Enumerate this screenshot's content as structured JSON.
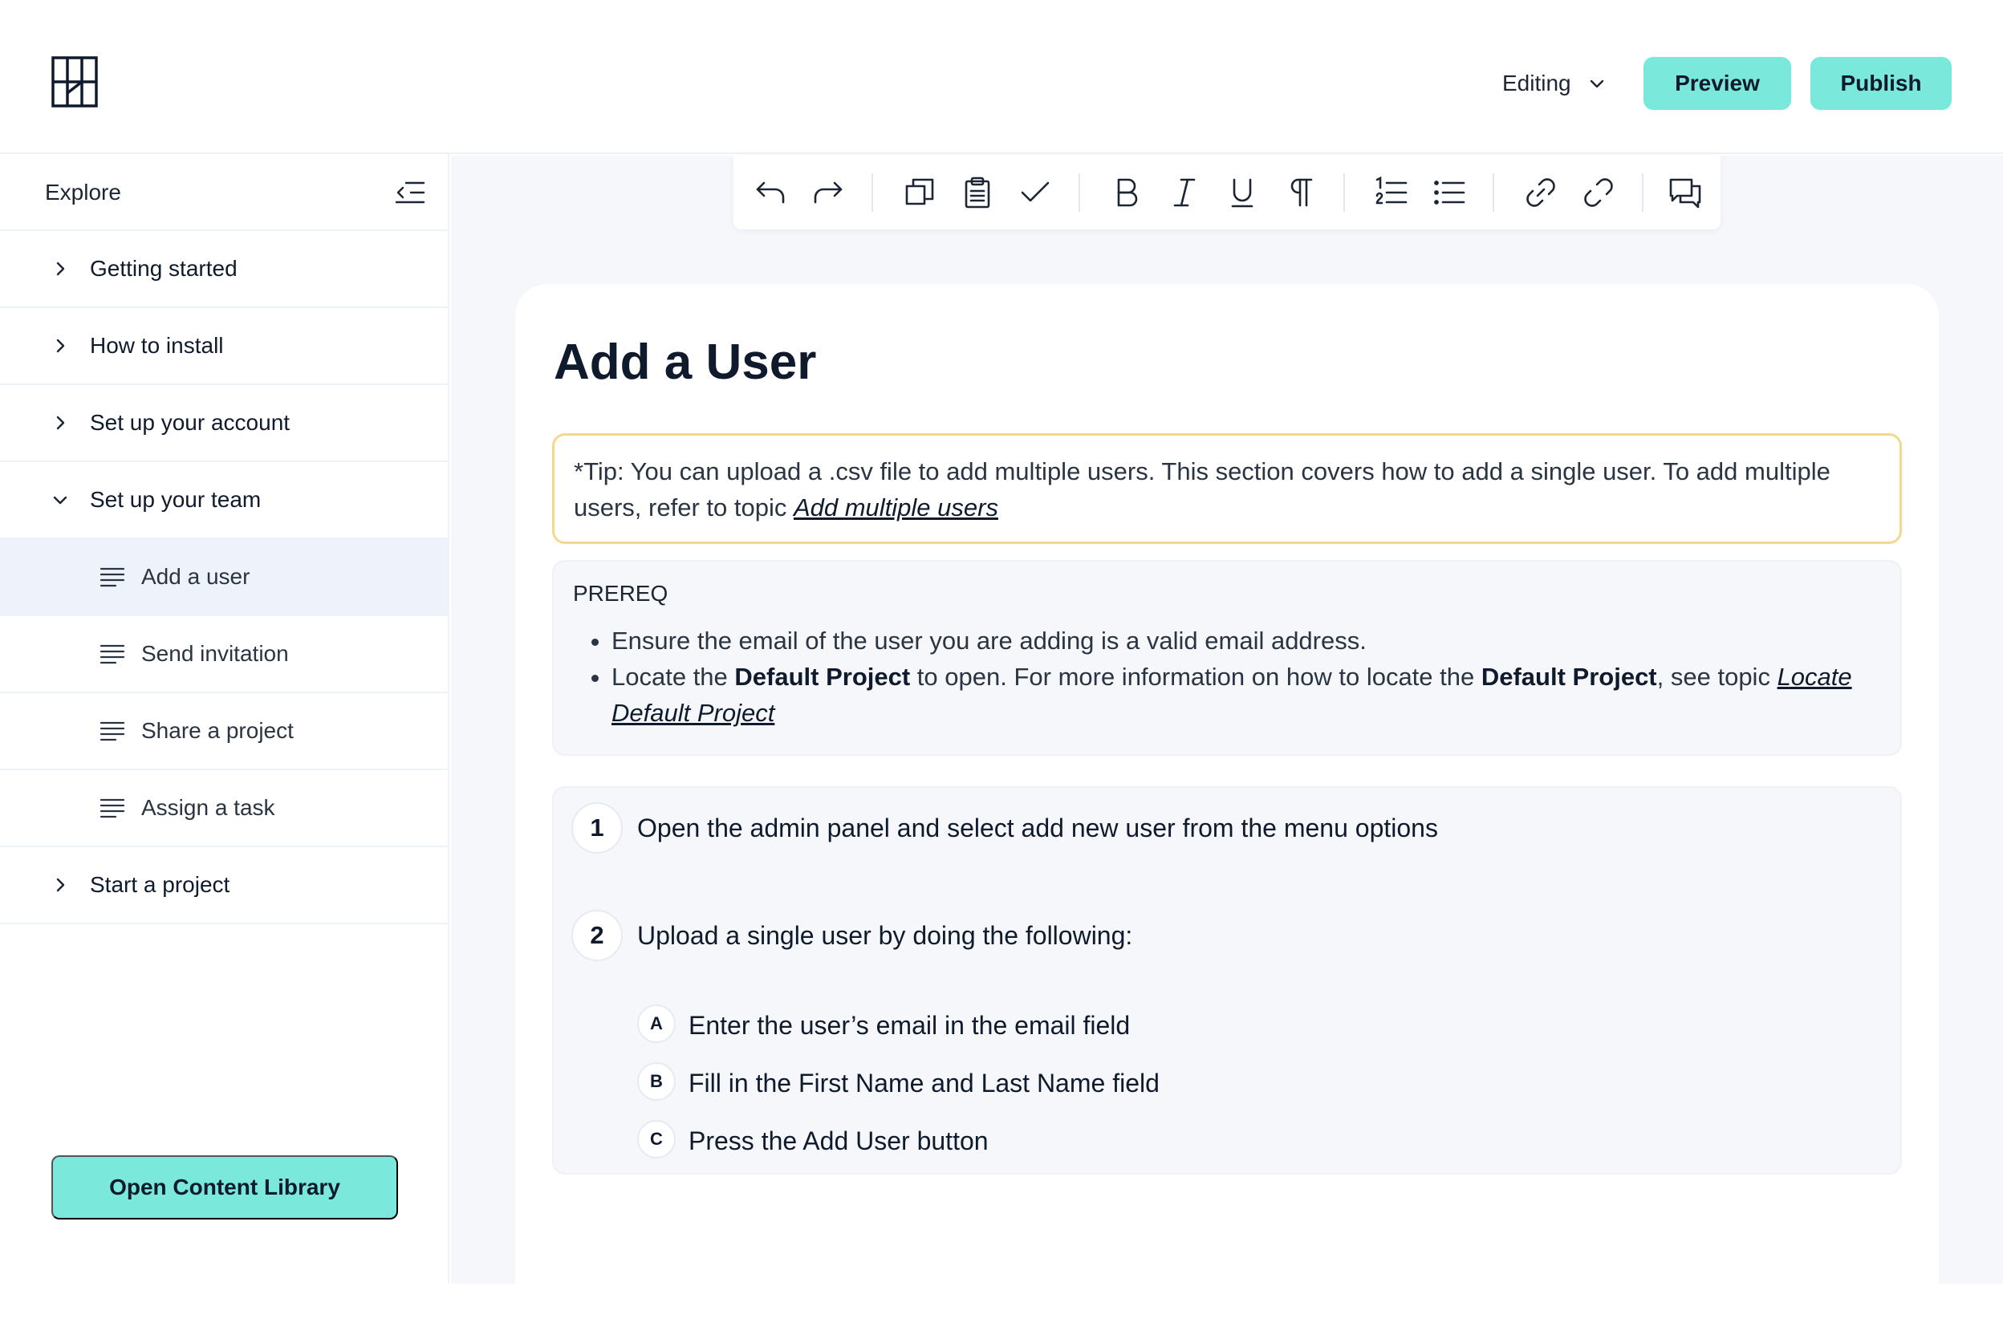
{
  "header": {
    "mode_label": "Editing",
    "preview_label": "Preview",
    "publish_label": "Publish"
  },
  "sidebar": {
    "title": "Explore",
    "items": [
      {
        "label": "Getting started",
        "expanded": false
      },
      {
        "label": "How to install",
        "expanded": false
      },
      {
        "label": "Set up your account",
        "expanded": false
      },
      {
        "label": "Set up your team",
        "expanded": true
      },
      {
        "label": "Add a user",
        "active": true
      },
      {
        "label": "Send invitation"
      },
      {
        "label": "Share a project"
      },
      {
        "label": "Assign a task"
      },
      {
        "label": "Start a project",
        "expanded": false
      }
    ],
    "library_button": "Open Content Library"
  },
  "toolbar": {
    "tools": [
      "undo-icon",
      "redo-icon",
      "copy-icon",
      "clipboard-icon",
      "check-icon",
      "bold-icon",
      "italic-icon",
      "underline-icon",
      "paragraph-icon",
      "numbered-list-icon",
      "bullet-list-icon",
      "link-icon",
      "unlink-icon",
      "comment-icon"
    ]
  },
  "doc": {
    "title": "Add a User",
    "tip": {
      "text": "*Tip: You can upload a .csv file to add multiple users. This section covers how to add a single user. To add multiple users, refer to topic ",
      "link": "Add multiple users"
    },
    "prereq": {
      "heading": "PREREQ",
      "item1": "Ensure the email of the user you are adding is a valid email address.",
      "item2_part1": "Locate the ",
      "item2_bold1": "Default Project",
      "item2_part2": " to open. For more information on how to locate the ",
      "item2_bold2": "Default Project",
      "item2_part3": ", see topic ",
      "item2_link": "Locate Default Project"
    },
    "steps": [
      {
        "num": "1",
        "text": "Open the admin panel and select add new user from the menu options"
      },
      {
        "num": "2",
        "text": "Upload a single user by doing the following:",
        "substeps": [
          {
            "letter": "A",
            "text": "Enter the user’s email in the email field"
          },
          {
            "letter": "B",
            "text": "Fill in the First Name and Last Name field"
          },
          {
            "letter": "C",
            "text": "Press the Add User button"
          }
        ]
      }
    ]
  },
  "colors": {
    "accent": "#7ae8db",
    "tip_border": "#f6d88c",
    "active_nav": "#eef3fb",
    "ink": "#0f1b2d"
  }
}
